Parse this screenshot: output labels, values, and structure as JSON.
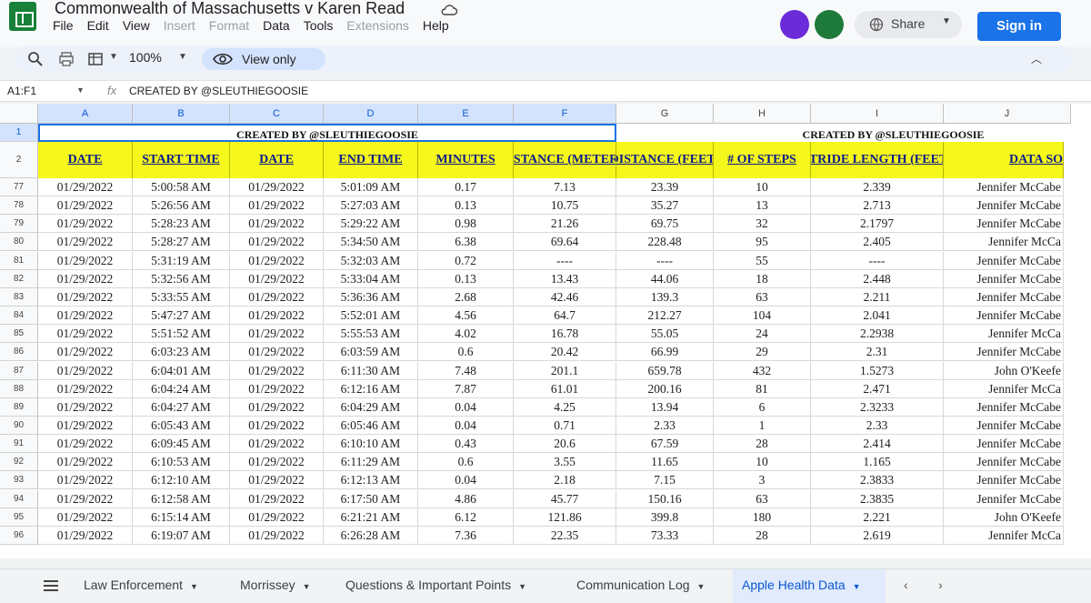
{
  "app": {
    "title": "Commonwealth of Massachusetts v Karen Read",
    "menus": [
      "File",
      "Edit",
      "View",
      "Insert",
      "Format",
      "Data",
      "Tools",
      "Extensions",
      "Help"
    ],
    "disabled_menus": [
      "Insert",
      "Format",
      "Extensions"
    ],
    "share_label": "Share",
    "sign_in_label": "Sign in"
  },
  "toolbar": {
    "zoom": "100%",
    "view_only_label": "View only"
  },
  "formula_bar": {
    "name_box": "A1:F1",
    "content": "CREATED BY @SLEUTHIEGOOSIE"
  },
  "columns": [
    "A",
    "B",
    "C",
    "D",
    "E",
    "F",
    "G",
    "H",
    "I",
    "J"
  ],
  "credit_text": "CREATED BY @SLEUTHIEGOOSIE",
  "headers": [
    "DATE",
    "START TIME",
    "DATE",
    "END TIME",
    "MINUTES",
    "DISTANCE (METERS)",
    "DISTANCE (FEET)",
    "# OF STEPS",
    "STRIDE LENGTH (FEET)",
    "DATA SO"
  ],
  "header_rows": [
    "1",
    "2"
  ],
  "rows": [
    {
      "n": "77",
      "c": [
        "01/29/2022",
        "5:00:58 AM",
        "01/29/2022",
        "5:01:09 AM",
        "0.17",
        "7.13",
        "23.39",
        "10",
        "2.339",
        "Jennifer McCabe"
      ]
    },
    {
      "n": "78",
      "c": [
        "01/29/2022",
        "5:26:56 AM",
        "01/29/2022",
        "5:27:03 AM",
        "0.13",
        "10.75",
        "35.27",
        "13",
        "2.713",
        "Jennifer McCabe"
      ]
    },
    {
      "n": "79",
      "c": [
        "01/29/2022",
        "5:28:23 AM",
        "01/29/2022",
        "5:29:22 AM",
        "0.98",
        "21.26",
        "69.75",
        "32",
        "2.1797",
        "Jennifer McCabe"
      ]
    },
    {
      "n": "80",
      "c": [
        "01/29/2022",
        "5:28:27 AM",
        "01/29/2022",
        "5:34:50 AM",
        "6.38",
        "69.64",
        "228.48",
        "95",
        "2.405",
        "Jennifer McCa"
      ]
    },
    {
      "n": "81",
      "c": [
        "01/29/2022",
        "5:31:19 AM",
        "01/29/2022",
        "5:32:03 AM",
        "0.72",
        "----",
        "----",
        "55",
        "----",
        "Jennifer McCabe"
      ]
    },
    {
      "n": "82",
      "c": [
        "01/29/2022",
        "5:32:56 AM",
        "01/29/2022",
        "5:33:04 AM",
        "0.13",
        "13.43",
        "44.06",
        "18",
        "2.448",
        "Jennifer McCabe"
      ]
    },
    {
      "n": "83",
      "c": [
        "01/29/2022",
        "5:33:55 AM",
        "01/29/2022",
        "5:36:36 AM",
        "2.68",
        "42.46",
        "139.3",
        "63",
        "2.211",
        "Jennifer McCabe"
      ]
    },
    {
      "n": "84",
      "c": [
        "01/29/2022",
        "5:47:27 AM",
        "01/29/2022",
        "5:52:01 AM",
        "4.56",
        "64.7",
        "212.27",
        "104",
        "2.041",
        "Jennifer McCabe"
      ]
    },
    {
      "n": "85",
      "c": [
        "01/29/2022",
        "5:51:52 AM",
        "01/29/2022",
        "5:55:53 AM",
        "4.02",
        "16.78",
        "55.05",
        "24",
        "2.2938",
        "Jennifer McCa"
      ]
    },
    {
      "n": "86",
      "c": [
        "01/29/2022",
        "6:03:23 AM",
        "01/29/2022",
        "6:03:59 AM",
        "0.6",
        "20.42",
        "66.99",
        "29",
        "2.31",
        "Jennifer McCabe"
      ]
    },
    {
      "n": "87",
      "c": [
        "01/29/2022",
        "6:04:01 AM",
        "01/29/2022",
        "6:11:30 AM",
        "7.48",
        "201.1",
        "659.78",
        "432",
        "1.5273",
        "John O'Keefe"
      ]
    },
    {
      "n": "88",
      "c": [
        "01/29/2022",
        "6:04:24 AM",
        "01/29/2022",
        "6:12:16 AM",
        "7.87",
        "61.01",
        "200.16",
        "81",
        "2.471",
        "Jennifer McCa"
      ]
    },
    {
      "n": "89",
      "c": [
        "01/29/2022",
        "6:04:27 AM",
        "01/29/2022",
        "6:04:29 AM",
        "0.04",
        "4.25",
        "13.94",
        "6",
        "2.3233",
        "Jennifer McCabe"
      ]
    },
    {
      "n": "90",
      "c": [
        "01/29/2022",
        "6:05:43 AM",
        "01/29/2022",
        "6:05:46 AM",
        "0.04",
        "0.71",
        "2.33",
        "1",
        "2.33",
        "Jennifer McCabe"
      ]
    },
    {
      "n": "91",
      "c": [
        "01/29/2022",
        "6:09:45 AM",
        "01/29/2022",
        "6:10:10 AM",
        "0.43",
        "20.6",
        "67.59",
        "28",
        "2.414",
        "Jennifer McCabe"
      ]
    },
    {
      "n": "92",
      "c": [
        "01/29/2022",
        "6:10:53 AM",
        "01/29/2022",
        "6:11:29 AM",
        "0.6",
        "3.55",
        "11.65",
        "10",
        "1.165",
        "Jennifer McCabe"
      ]
    },
    {
      "n": "93",
      "c": [
        "01/29/2022",
        "6:12:10 AM",
        "01/29/2022",
        "6:12:13 AM",
        "0.04",
        "2.18",
        "7.15",
        "3",
        "2.3833",
        "Jennifer McCabe"
      ]
    },
    {
      "n": "94",
      "c": [
        "01/29/2022",
        "6:12:58 AM",
        "01/29/2022",
        "6:17:50 AM",
        "4.86",
        "45.77",
        "150.16",
        "63",
        "2.3835",
        "Jennifer McCabe"
      ]
    },
    {
      "n": "95",
      "c": [
        "01/29/2022",
        "6:15:14 AM",
        "01/29/2022",
        "6:21:21 AM",
        "6.12",
        "121.86",
        "399.8",
        "180",
        "2.221",
        "John O'Keefe"
      ]
    },
    {
      "n": "96",
      "c": [
        "01/29/2022",
        "6:19:07 AM",
        "01/29/2022",
        "6:26:28 AM",
        "7.36",
        "22.35",
        "73.33",
        "28",
        "2.619",
        "Jennifer McCa"
      ]
    }
  ],
  "sheet_tabs": [
    {
      "label": "Law Enforcement",
      "active": false
    },
    {
      "label": "Morrissey",
      "active": false
    },
    {
      "label": "Questions & Important Points",
      "active": false
    },
    {
      "label": "Communication Log",
      "active": false
    },
    {
      "label": "Apple Health Data",
      "active": true
    }
  ],
  "colors": {
    "header_fill": "#f6f71a",
    "header_text": "#0c1d8a",
    "accent": "#1a73e8",
    "brand": "#188038"
  },
  "icons": [
    "sheets-logo-icon",
    "cloud-icon",
    "globe-icon",
    "search-icon",
    "print-icon",
    "format-icon",
    "eye-icon",
    "function-icon",
    "menu-icon",
    "chevron-left-icon",
    "chevron-right-icon"
  ]
}
